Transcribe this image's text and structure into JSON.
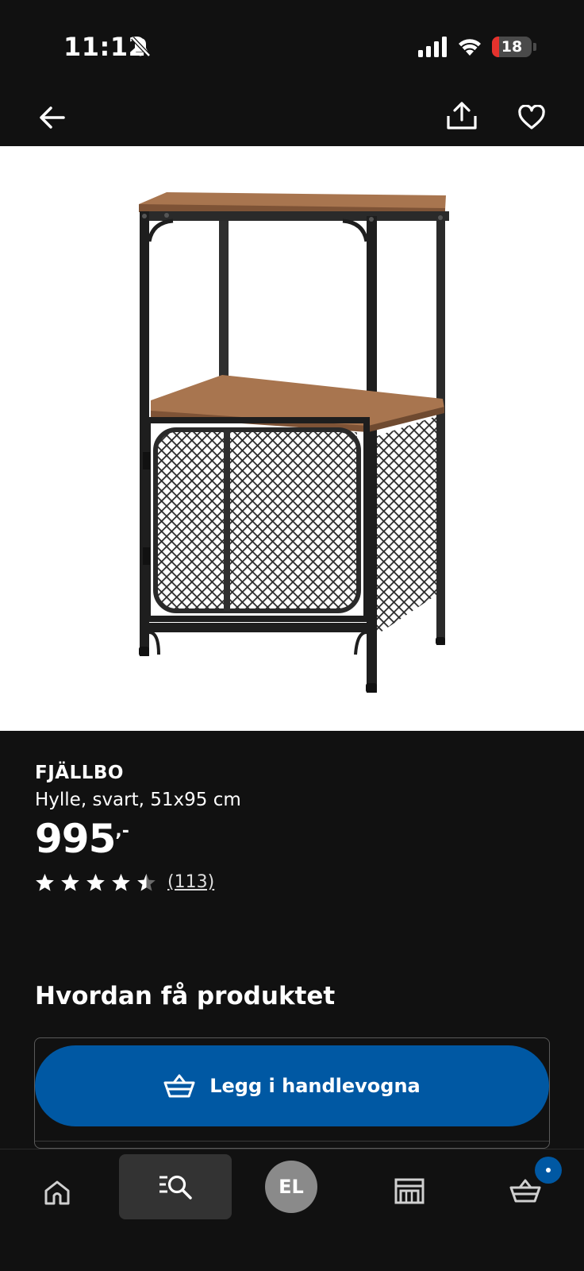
{
  "status_bar": {
    "time": "11:12",
    "battery_level": "18",
    "battery_fraction": 0.18
  },
  "nav": {
    "back_icon": "arrow-left-icon",
    "share_icon": "share-icon",
    "favorite_icon": "heart-icon"
  },
  "product": {
    "name": "FJÄLLBO",
    "description": "Hylle, svart, 51x95 cm",
    "price": "995",
    "price_suffix": ",-",
    "rating": 4.5,
    "rating_max": 5,
    "review_count": "(113)"
  },
  "delivery": {
    "section_title": "Hvordan få produktet",
    "add_to_cart_label": "Legg i handlevogna"
  },
  "bottom_nav": {
    "items": [
      {
        "icon": "home-icon"
      },
      {
        "icon": "search-list-icon",
        "active": true
      },
      {
        "label": "EL"
      },
      {
        "icon": "store-icon"
      },
      {
        "icon": "cart-icon"
      }
    ]
  },
  "colors": {
    "background": "#111111",
    "accent": "#0058a3",
    "battery_low": "#e5322d"
  }
}
